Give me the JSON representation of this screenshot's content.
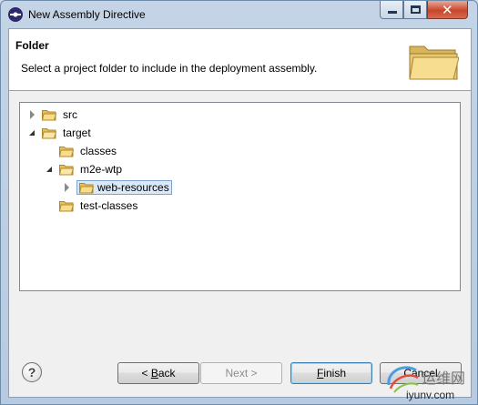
{
  "window": {
    "title": "New Assembly Directive"
  },
  "header": {
    "title": "Folder",
    "description": "Select a project folder to include in the deployment assembly."
  },
  "tree": {
    "items": [
      {
        "label": "src",
        "expanded": false,
        "depth": 0
      },
      {
        "label": "target",
        "expanded": true,
        "depth": 0
      },
      {
        "label": "classes",
        "expanded": null,
        "depth": 1
      },
      {
        "label": "m2e-wtp",
        "expanded": true,
        "depth": 1
      },
      {
        "label": "web-resources",
        "expanded": false,
        "depth": 2,
        "selected": true
      },
      {
        "label": "test-classes",
        "expanded": null,
        "depth": 1
      }
    ]
  },
  "buttons": {
    "help": "?",
    "back_prefix": "< ",
    "back_mnemonic": "B",
    "back_rest": "ack",
    "next": "Next >",
    "finish_mnemonic": "F",
    "finish_rest": "inish",
    "cancel": "Cancel"
  },
  "watermark": {
    "text": "iyunv.com",
    "logo_text": "运维网"
  },
  "colors": {
    "selection": "#dbe8f8",
    "folder": "#f5d37d",
    "title_bar": "#c4d4e6"
  }
}
